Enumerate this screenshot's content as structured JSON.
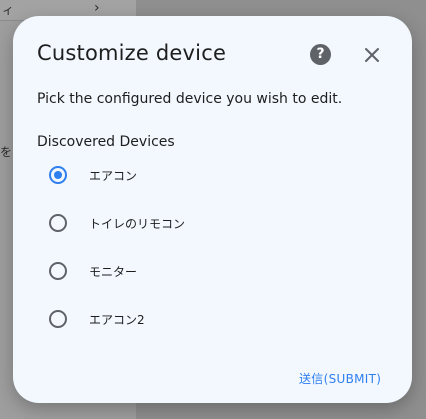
{
  "background": {
    "text_top": "ィ",
    "text_mid": "を"
  },
  "dialog": {
    "title": "Customize device",
    "help_icon": "?",
    "description": "Pick the configured device you wish to edit.",
    "section_label": "Discovered Devices",
    "options": [
      {
        "label": "エアコン",
        "selected": true
      },
      {
        "label": "トイレのリモコン",
        "selected": false
      },
      {
        "label": "モニター",
        "selected": false
      },
      {
        "label": "エアコン2",
        "selected": false
      }
    ],
    "submit_label": "送信(SUBMIT)"
  },
  "colors": {
    "accent": "#2f7ff0",
    "dialog_bg": "#f2f8fe",
    "icon": "#5f6368"
  }
}
